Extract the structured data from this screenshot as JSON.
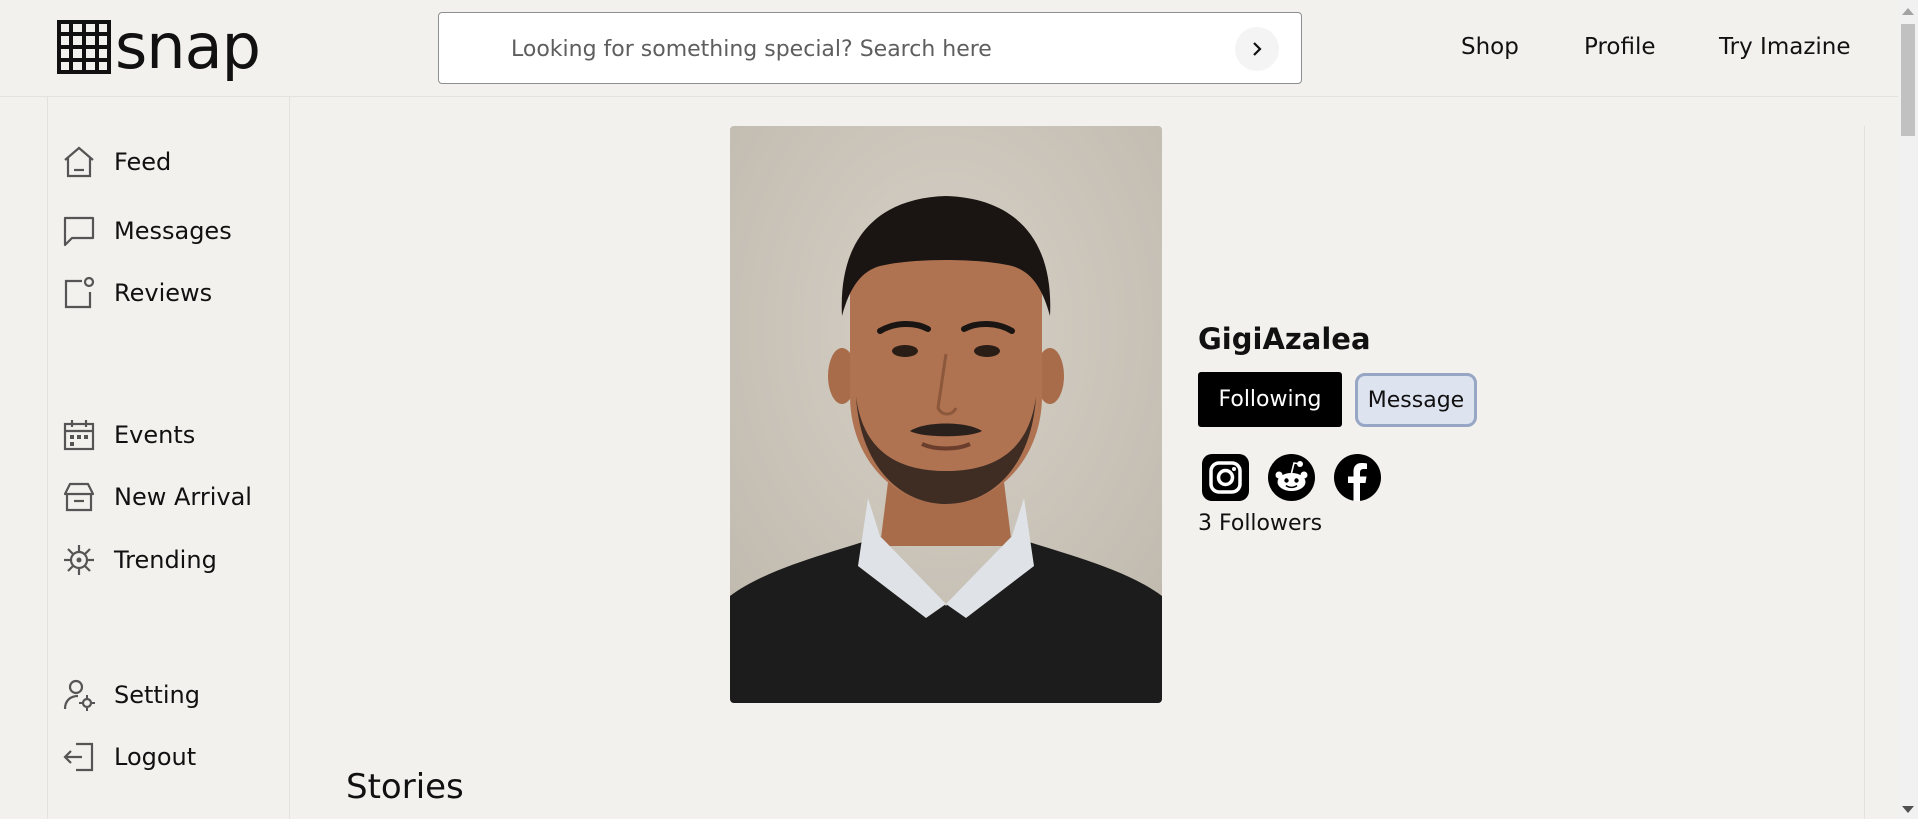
{
  "brand": {
    "name": "snap"
  },
  "search": {
    "placeholder": "Looking for something special? Search here",
    "go_icon": "chevron-right-icon"
  },
  "topnav": {
    "items": [
      "Shop",
      "Profile",
      "Try Imazine"
    ]
  },
  "sidebar": {
    "items": [
      {
        "label": "Feed",
        "icon": "home-icon"
      },
      {
        "label": "Messages",
        "icon": "message-square-icon"
      },
      {
        "label": "Reviews",
        "icon": "review-icon"
      },
      {
        "label": "Events",
        "icon": "calendar-icon"
      },
      {
        "label": "New Arrival",
        "icon": "store-icon"
      },
      {
        "label": "Trending",
        "icon": "virus-icon"
      },
      {
        "label": "Setting",
        "icon": "user-settings-icon"
      },
      {
        "label": "Logout",
        "icon": "logout-icon"
      }
    ]
  },
  "profile": {
    "username": "GigiAzalea",
    "following_label": "Following",
    "message_label": "Message",
    "followers_text": "3 Followers",
    "socials": [
      "instagram-icon",
      "reddit-icon",
      "facebook-icon"
    ]
  },
  "section": {
    "stories_title": "Stories"
  },
  "colors": {
    "background": "#f2f1ee",
    "primary_button": "#000000",
    "secondary_button": "#dde3ef",
    "secondary_border": "#97a6c4"
  }
}
